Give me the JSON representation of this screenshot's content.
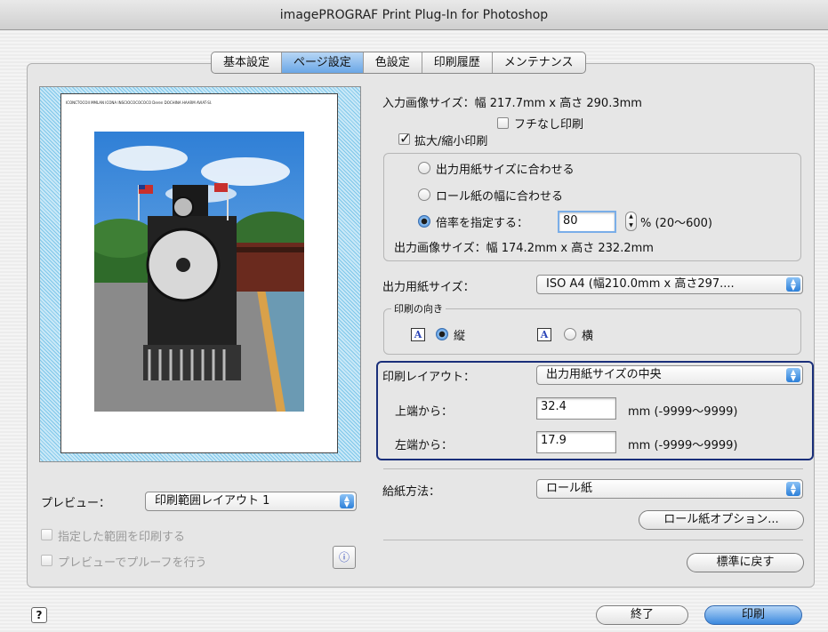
{
  "window": {
    "title": "imagePROGRAF Print Plug-In for Photoshop"
  },
  "tabs": [
    {
      "label": "基本設定",
      "active": false
    },
    {
      "label": "ページ設定",
      "active": true
    },
    {
      "label": "色設定",
      "active": false
    },
    {
      "label": "印刷履歴",
      "active": false
    },
    {
      "label": "メンテナンス",
      "active": false
    }
  ],
  "preview_panel": {
    "header_text": "ICONCTOCOII MMLAN ICONA INSCIOCOCOCOCO Deren DOCHINA HAARM AVIAT-SI.",
    "preview_label": "プレビュー：",
    "preview_select": "印刷範囲レイアウト 1",
    "print_range_label": "指定した範囲を印刷する",
    "proof_label": "プレビューでプルーフを行う",
    "info_icon": "info-icon"
  },
  "settings": {
    "input_image_size": "入力画像サイズ：幅 217.7mm x 高さ 290.3mm",
    "borderless_label": "フチなし印刷",
    "borderless_checked": false,
    "scale_label": "拡大/縮小印刷",
    "scale_checked": true,
    "fit_paper_label": "出力用紙サイズに合わせる",
    "fit_roll_label": "ロール紙の幅に合わせる",
    "scale_ratio_label": "倍率を指定する：",
    "scale_value": "80",
    "scale_range": "% (20〜600)",
    "output_image_size": "出力画像サイズ：幅 174.2mm x 高さ 232.2mm",
    "paper_size_label": "出力用紙サイズ：",
    "paper_size_value": "ISO A4 (幅210.0mm x 高さ297....",
    "orientation_group": "印刷の向き",
    "portrait_label": "縦",
    "landscape_label": "横",
    "orientation_icon_letter": "A",
    "layout_label": "印刷レイアウト：",
    "layout_value": "出力用紙サイズの中央",
    "top_label": "上端から：",
    "top_value": "32.4",
    "top_range": "mm (-9999〜9999)",
    "left_label": "左端から：",
    "left_value": "17.9",
    "left_range": "mm (-9999〜9999)",
    "feed_label": "給紙方法：",
    "feed_value": "ロール紙",
    "roll_options_button": "ロール紙オプション...",
    "reset_button": "標準に戻す"
  },
  "footer": {
    "help_icon": "help-icon",
    "help_glyph": "?",
    "quit_button": "終了",
    "print_button": "印刷"
  },
  "colors": {
    "accent_blue": "#3c89de",
    "highlight_border": "#1a2f7a"
  }
}
